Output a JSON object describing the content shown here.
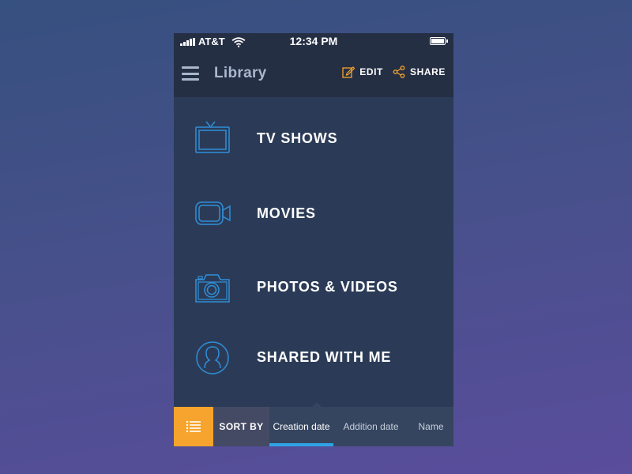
{
  "status_bar": {
    "carrier": "AT&T",
    "time": "12:34 PM",
    "signal_icon": "signal-icon",
    "wifi_icon": "wifi-icon",
    "battery_icon": "battery-icon",
    "battery_level": 1.0
  },
  "header": {
    "title": "Library",
    "menu_icon": "hamburger-icon",
    "actions": [
      {
        "label": "EDIT",
        "icon": "edit-icon"
      },
      {
        "label": "SHARE",
        "icon": "share-icon"
      }
    ]
  },
  "menu": {
    "items": [
      {
        "label": "TV SHOWS",
        "icon": "tv-icon"
      },
      {
        "label": "MOVIES",
        "icon": "video-camera-icon"
      },
      {
        "label": "PHOTOS & VIDEOS",
        "icon": "camera-icon"
      },
      {
        "label": "SHARED WITH ME",
        "icon": "user-icon"
      }
    ]
  },
  "sort_bar": {
    "list_icon": "list-icon",
    "label": "SORT BY",
    "options": [
      "Creation date",
      "Addition date",
      "Name"
    ],
    "selected": "Creation date"
  },
  "colors": {
    "background_top": "#36507f",
    "background_bottom": "#5a4d9c",
    "panel": "#2b3b57",
    "header": "#252f44",
    "icon_blue": "#2f8fd8",
    "accent_orange": "#f6a42d",
    "active_underline": "#2fa3e6"
  }
}
